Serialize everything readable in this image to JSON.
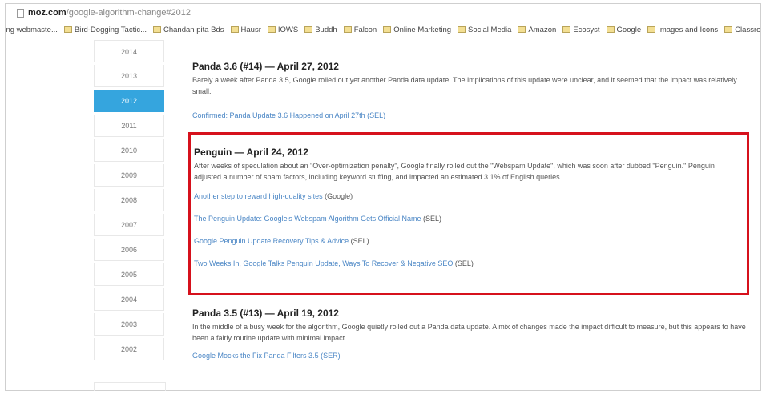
{
  "address_bar": {
    "domain": "moz.com",
    "path": "/google-algorithm-change#2012"
  },
  "bookmarks": [
    "Bing webmaste...",
    "Bird-Dogging Tactic...",
    "Chandan pita Bds",
    "Hausr",
    "IOWS",
    "Buddh",
    "Falcon",
    "Online Marketing",
    "Social Media",
    "Amazon",
    "Ecosyst",
    "Google",
    "Images and Icons",
    "Classroo"
  ],
  "years": [
    "2014",
    "2013",
    "2012",
    "2011",
    "2010",
    "2009",
    "2008",
    "2007",
    "2006",
    "2005",
    "2004",
    "2003",
    "2002"
  ],
  "active_year": "2012",
  "updates": {
    "panda1": {
      "title": "Panda 3.6 (#14) — April 27, 2012",
      "body": "Barely a week after Panda 3.5, Google rolled out yet another Panda data update. The implications of this update were unclear, and it seemed that the impact was relatively small.",
      "link": "Confirmed: Panda Update 3.6 Happened on April 27th (SEL)"
    },
    "penguin": {
      "title": "Penguin — April 24, 2012",
      "body": "After weeks of speculation about an \"Over-optimization penalty\", Google finally rolled out the \"Webspam Update\", which was soon after dubbed \"Penguin.\" Penguin adjusted a number of spam factors, including keyword stuffing, and impacted an estimated 3.1% of English queries.",
      "links": [
        {
          "text": "Another step to reward high-quality sites",
          "suffix": " (Google)"
        },
        {
          "text": "The Penguin Update: Google's Webspam Algorithm Gets Official Name",
          "suffix": " (SEL)"
        },
        {
          "text": "Google Penguin Update Recovery Tips & Advice",
          "suffix": " (SEL)"
        },
        {
          "text": "Two Weeks In, Google Talks Penguin Update, Ways To Recover & Negative SEO",
          "suffix": " (SEL)"
        }
      ]
    },
    "panda2": {
      "title": "Panda 3.5 (#13) — April 19, 2012",
      "body": "In the middle of a busy week for the algorithm, Google quietly rolled out a Panda data update. A mix of changes made the impact difficult to measure, but this appears to have been a fairly routine update with minimal impact.",
      "link": "Google Mocks the Fix Panda Filters 3.5 (SER)"
    }
  }
}
